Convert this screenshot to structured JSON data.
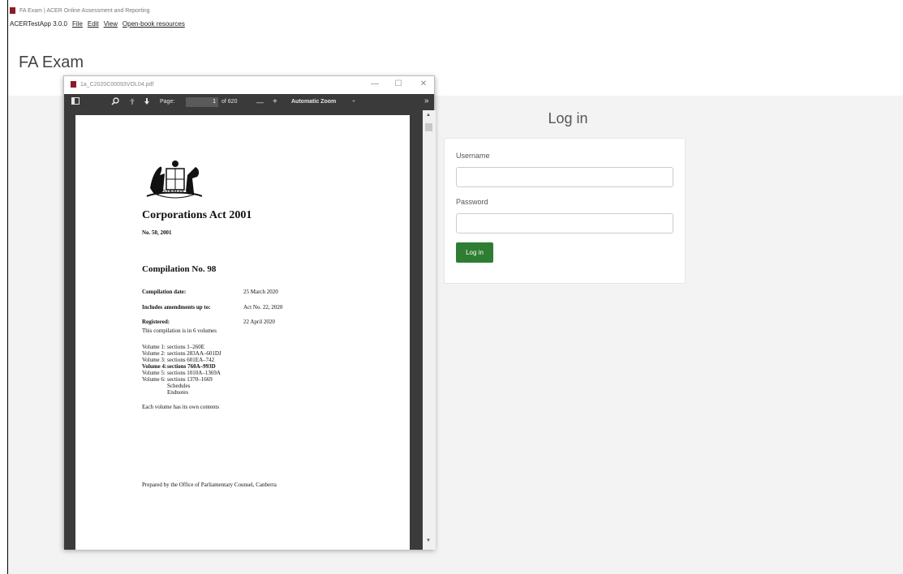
{
  "window": {
    "title": "FA Exam | ACER Online Assessment and Reporting"
  },
  "menubar": {
    "app_version": "ACERTestApp 3.0.0",
    "items": [
      "File",
      "Edit",
      "View",
      "Open-book resources"
    ]
  },
  "exam": {
    "title": "FA Exam"
  },
  "login": {
    "heading": "Log in",
    "username_label": "Username",
    "username_value": "",
    "password_label": "Password",
    "password_value": "",
    "button_label": "Log in"
  },
  "pdf_viewer": {
    "filename": "1a_C2020C00093VOL04.pdf",
    "controls": {
      "minimize": "—",
      "maximize": "☐",
      "close": "✕"
    },
    "toolbar": {
      "page_label": "Page:",
      "page_value": "1",
      "page_total": "of 620",
      "zoom_out": "—",
      "zoom_in": "+",
      "zoom": "Automatic Zoom",
      "zoom_arrow": "÷",
      "more": "»"
    },
    "document": {
      "crest_label": "AUSTRALIA",
      "title": "Corporations Act 2001",
      "act_no": "No. 50, 2001",
      "compilation": "Compilation No. 98",
      "details": [
        {
          "label": "Compilation date:",
          "value": "25 March 2020"
        },
        {
          "label": "Includes amendments up to:",
          "value": "Act No. 22, 2020"
        },
        {
          "label": "Registered:",
          "value": "22 April 2020"
        }
      ],
      "volumes_note": "This compilation is in 6 volumes",
      "volumes": [
        {
          "vol": "Volume 1:",
          "range": "sections 1–260E",
          "bold": false
        },
        {
          "vol": "Volume 2:",
          "range": "sections 283AA–601DJ",
          "bold": false
        },
        {
          "vol": "Volume 3:",
          "range": "sections 601EA–742",
          "bold": false
        },
        {
          "vol": "Volume 4:",
          "range": "sections 760A–993D",
          "bold": true
        },
        {
          "vol": "Volume 5:",
          "range": "sections 1010A–1369A",
          "bold": false
        },
        {
          "vol": "Volume 6:",
          "range": "sections 1370–1669",
          "bold": false
        }
      ],
      "vol6_extra": [
        "Schedules",
        "Endnotes"
      ],
      "contents_note": "Each volume has its own contents",
      "footer": "Prepared by the Office of Parliamentary Counsel, Canberra"
    }
  },
  "colors": {
    "accent_green": "#2e7d32",
    "toolbar_dark": "#3a3a3a",
    "app_icon": "#8b1a2b"
  }
}
